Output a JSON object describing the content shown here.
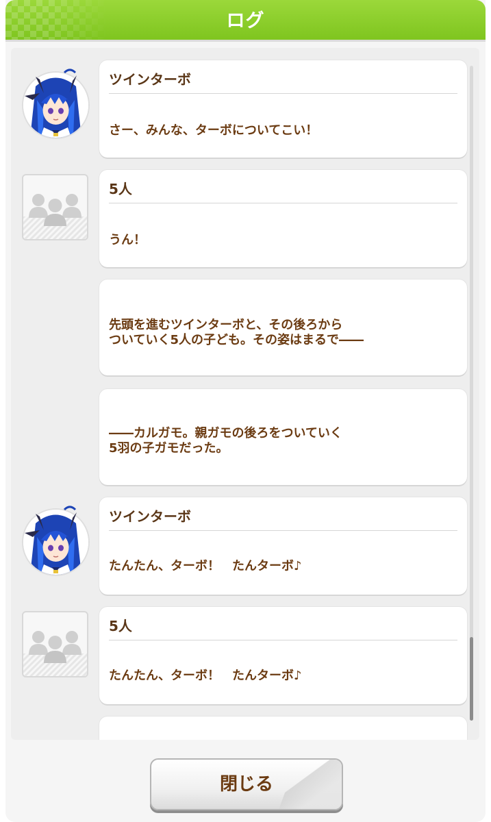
{
  "header": {
    "title": "ログ"
  },
  "entries": [
    {
      "speaker": "ツインターボ",
      "lines": [
        "さー、みんな、ターボについてこい！"
      ]
    },
    {
      "speaker": "5人",
      "lines": [
        "うん！"
      ]
    },
    {
      "lines": [
        "先頭を進むツインターボと、その後ろから",
        "ついていく5人の子ども。その姿はまるで――"
      ]
    },
    {
      "lines": [
        "――カルガモ。親ガモの後ろをついていく",
        "5羽の子ガモだった。"
      ]
    },
    {
      "speaker": "ツインターボ",
      "lines": [
        "たんたん、ターボ！　たんターボ♪"
      ]
    },
    {
      "speaker": "5人",
      "lines": [
        "たんたん、ターボ！　たんターボ♪"
      ]
    }
  ],
  "footer": {
    "close_label": "閉じる"
  },
  "colors": {
    "header_green": "#8ccf2b",
    "text_brown": "#6b3b12"
  },
  "icons": {
    "character_avatar": "twin-turbo-portrait",
    "group_avatar": "group-people-icon"
  }
}
